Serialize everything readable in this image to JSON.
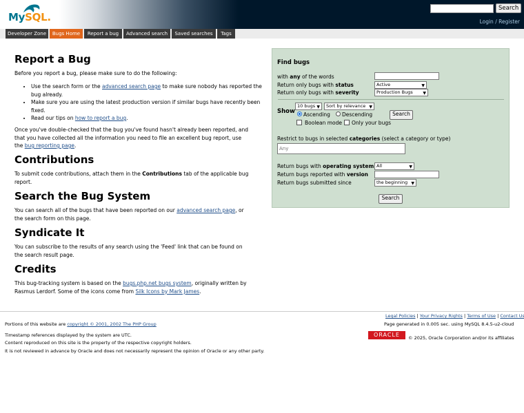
{
  "header": {
    "logo_part1": "My",
    "logo_part2": "SQL",
    "logo_dot": ".",
    "search_button": "Search",
    "search_value": "",
    "login": "Login",
    "sep": "/",
    "register": "Register"
  },
  "nav": {
    "tabs": [
      "Developer Zone",
      "Bugs Home",
      "Report a bug",
      "Advanced search",
      "Saved searches",
      "Tags"
    ],
    "active_index": 1
  },
  "content": {
    "report_title": "Report a Bug",
    "report_intro": "Before you report a bug, please make sure to do the following:",
    "bullet1_pre": "Use the search form or the ",
    "bullet1_link": "advanced search page",
    "bullet1_post": " to make sure nobody has reported the bug already.",
    "bullet2": "Make sure you are using the latest production version if similar bugs have recently been fixed.",
    "bullet3_pre": "Read our tips on ",
    "bullet3_link": "how to report a bug",
    "bullet3_post": ".",
    "report_closing_pre": "Once you've double-checked that the bug you've found hasn't already been reported, and that you have collected all the information you need to file an excellent bug report, use the ",
    "report_closing_link": "bug reporting page",
    "report_closing_post": ".",
    "contrib_title": "Contributions",
    "contrib_pre": "To submit code contributions, attach them in the ",
    "contrib_bold": "Contributions",
    "contrib_post": " tab of the applicable bug report.",
    "search_title": "Search the Bug System",
    "search_pre": "You can search all of the bugs that have been reported on our ",
    "search_link": "advanced search page",
    "search_post": ", or the search form on this page.",
    "syndicate_title": "Syndicate It",
    "syndicate_text": "You can subscribe to the results of any search using the 'Feed' link that can be found on the search result page.",
    "credits_title": "Credits",
    "credits_pre": "This bug-tracking system is based on the ",
    "credits_link1": "bugs.php.net bugs system",
    "credits_mid": ", originally written by Rasmus Lerdorf. Some of the icons come from ",
    "credits_link2": "Silk Icons by Mark James",
    "credits_post": "."
  },
  "find": {
    "title": "Find bugs",
    "words_pre": "with ",
    "words_bold": "any",
    "words_post": " of the words",
    "words_value": "",
    "status_pre": "Return only bugs with ",
    "status_bold": "status",
    "status_value": "Active",
    "severity_pre": "Return only bugs with ",
    "severity_bold": "severity",
    "severity_value": "Production Bugs",
    "show_label": "Show",
    "show_count": "10 bugs",
    "sort_value": "Sort by relevance",
    "ascending": "Ascending",
    "descending": "Descending",
    "boolean_mode": "Boolean mode",
    "only_your_bugs": "Only your bugs",
    "search_button": "Search",
    "restrict_pre": "Restrict to bugs in selected ",
    "restrict_bold": "categories",
    "restrict_post": " (select a category or type)",
    "category_placeholder": "Any",
    "os_pre": "Return bugs with ",
    "os_bold": "operating system",
    "os_value": "All",
    "version_pre": "Return bugs reported with ",
    "version_bold": "version",
    "version_value": "",
    "since_label": "Return bugs submitted since",
    "since_value": "the beginning",
    "bottom_search_button": "Search"
  },
  "footer": {
    "portions_pre": "Portions of this website are ",
    "portions_link": "copyright © 2001, 2002 The PHP Group",
    "timestamp": "Timestamp references displayed by the system are UTC.",
    "content_property": "Content reproduced on this site is the property of the respective copyright holders.",
    "not_reviewed": "It is not reviewed in advance by Oracle and does not necessarily represent the opinion of Oracle or any other party.",
    "legal": "Legal Policies",
    "privacy": "Your Privacy Rights",
    "terms": "Terms of Use",
    "contact": "Contact Us",
    "sep": "|",
    "generated": "Page generated in 0.005 sec. using MySQL 8.4.5-u2-cloud",
    "oracle_logo": "ORACLE",
    "oracle_copy": "© 2025, Oracle Corporation and/or its affiliates"
  },
  "colors": {
    "header_bg": "#00172a",
    "nav_active": "#e0661c",
    "nav_tab": "#3a3a3a",
    "panel_bg": "#cfdfd0",
    "link": "#1f4e8a",
    "oracle_red": "#d2181f"
  }
}
